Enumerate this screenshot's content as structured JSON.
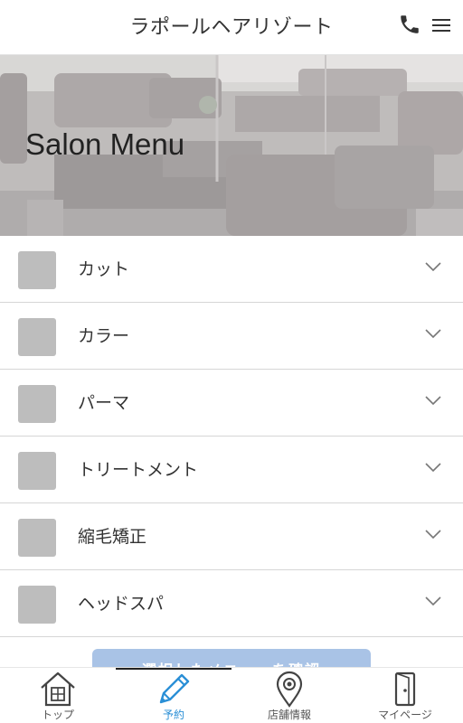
{
  "header": {
    "title": "ラポールヘアリゾート",
    "phone_icon": "phone-icon",
    "menu_icon": "hamburger-menu-icon"
  },
  "hero": {
    "title": "Salon Menu"
  },
  "menu": {
    "items": [
      {
        "label": "カット"
      },
      {
        "label": "カラー"
      },
      {
        "label": "パーマ"
      },
      {
        "label": "トリートメント"
      },
      {
        "label": "縮毛矯正"
      },
      {
        "label": "ヘッドスパ"
      }
    ]
  },
  "partial_button": {
    "label": "選択したメニューを確認"
  },
  "tabbar": {
    "tabs": [
      {
        "label": "トップ",
        "icon": "home-icon"
      },
      {
        "label": "予約",
        "icon": "pencil-icon",
        "active": true
      },
      {
        "label": "店舗情報",
        "icon": "map-pin-icon"
      },
      {
        "label": "マイページ",
        "icon": "door-icon"
      }
    ]
  },
  "colors": {
    "accent": "#2a8fd6",
    "thumb_placeholder": "#bdbdbd",
    "button_faded": "#a9c3e6"
  }
}
